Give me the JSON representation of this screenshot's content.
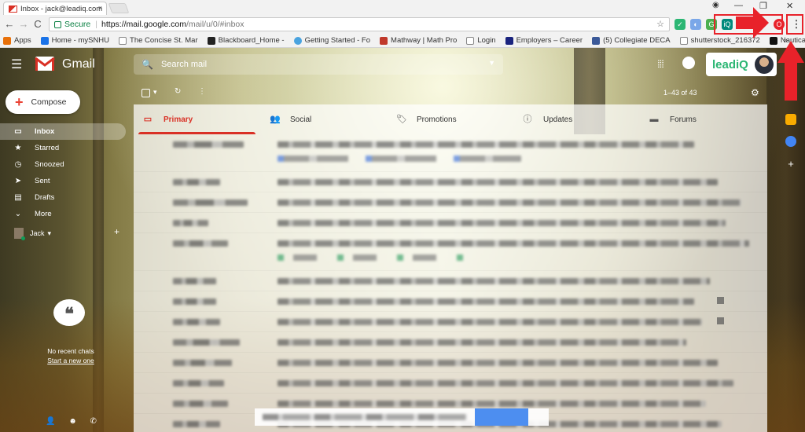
{
  "browser": {
    "tab_title": "Inbox - jack@leadiq.com",
    "tab_close": "×",
    "window_controls": [
      "—",
      "❐",
      "✕"
    ],
    "nav": {
      "back": "←",
      "forward": "→",
      "reload": "C"
    },
    "secure_label": "Secure",
    "url_host": "https://mail.google.com",
    "url_path": "/mail/u/0/#inbox",
    "star": "☆",
    "menu_dots": "⋮",
    "bookmarks": [
      {
        "label": "Apps",
        "color": "#e8710a"
      },
      {
        "label": "Home - mySNHU",
        "color": "#1a73e8"
      },
      {
        "label": "The Concise St. Mar",
        "color": "#888888"
      },
      {
        "label": "Blackboard_Home -",
        "color": "#222222"
      },
      {
        "label": "Getting Started - Fo",
        "color": "#4aa3df"
      },
      {
        "label": "Mathway | Math Pro",
        "color": "#c0392b"
      },
      {
        "label": "Login",
        "color": "#888888"
      },
      {
        "label": "Employers – Career",
        "color": "#1a237e"
      },
      {
        "label": "(5) Collegiate DECA",
        "color": "#3b5998"
      },
      {
        "label": "shutterstock_216372",
        "color": "#888888"
      },
      {
        "label": "Nautica + Ur Printe",
        "color": "#111111"
      }
    ],
    "bookmarks_more": "»"
  },
  "gmail": {
    "menu_icon": "☰",
    "app_name": "Gmail",
    "search_placeholder": "Search mail",
    "search_icon": "🔍",
    "search_caret": "▼",
    "apps_icon": "⁞⁞⁞",
    "leadiq_label": "leadiQ",
    "compose_label": "Compose",
    "compose_plus": "+",
    "nav": [
      {
        "icon": "▭",
        "label": "Inbox",
        "active": true
      },
      {
        "icon": "★",
        "label": "Starred",
        "active": false
      },
      {
        "icon": "◷",
        "label": "Snoozed",
        "active": false
      },
      {
        "icon": "➤",
        "label": "Sent",
        "active": false
      },
      {
        "icon": "▤",
        "label": "Drafts",
        "active": false
      },
      {
        "icon": "⌄",
        "label": "More",
        "active": false
      }
    ],
    "hangout_user": "Jack",
    "hangout_caret": "▾",
    "hangout_plus": "+",
    "chat_bubble": "❝",
    "no_chats": "No recent chats",
    "start_chat": "Start a new one",
    "bottom_icons": [
      "👤",
      "☻",
      "✆"
    ],
    "toolbar": {
      "refresh": "↻",
      "more": "⋮",
      "select_caret": "▾",
      "pager": "1–43 of 43",
      "settings": "⚙"
    },
    "categories": [
      {
        "icon": "▭",
        "label": "Primary",
        "active": true
      },
      {
        "icon": "👥",
        "label": "Social",
        "active": false
      },
      {
        "icon": "🏷",
        "label": "Promotions",
        "active": false
      },
      {
        "icon": "ⓘ",
        "label": "Updates",
        "active": false
      },
      {
        "icon": "▬",
        "label": "Forums",
        "active": false
      }
    ],
    "side_panel_plus": "+",
    "colors": {
      "primary_red": "#d93025",
      "leadiq_green": "#2bb673",
      "annotation_red": "#e8222a"
    }
  }
}
